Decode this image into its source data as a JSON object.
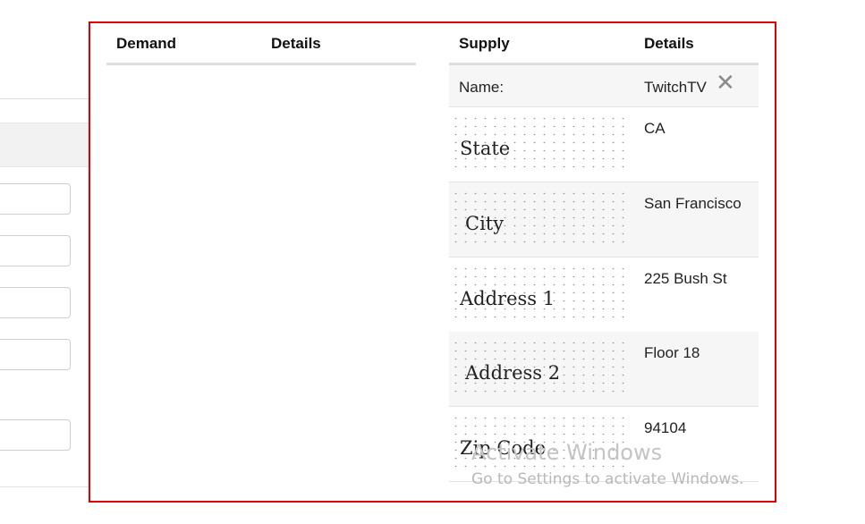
{
  "demand_table": {
    "headers": {
      "demand": "Demand",
      "details": "Details"
    }
  },
  "supply_table": {
    "headers": {
      "supply": "Supply",
      "details": "Details"
    },
    "name_row": {
      "label": "Name:",
      "value": "TwitchTV",
      "remove_icon": "close-icon"
    },
    "rows": [
      {
        "label": "State",
        "value": "CA"
      },
      {
        "label": "City",
        "value": "San Francisco"
      },
      {
        "label": "Address 1",
        "value": "225 Bush St"
      },
      {
        "label": "Address 2",
        "value": "Floor 18"
      },
      {
        "label": "Zip Code",
        "value": "94104"
      }
    ]
  },
  "watermark": {
    "title": "Activate Windows",
    "subtitle": "Go to Settings to activate Windows."
  },
  "colors": {
    "highlight_border": "#e00000",
    "row_shade": "#f6f6f6"
  }
}
